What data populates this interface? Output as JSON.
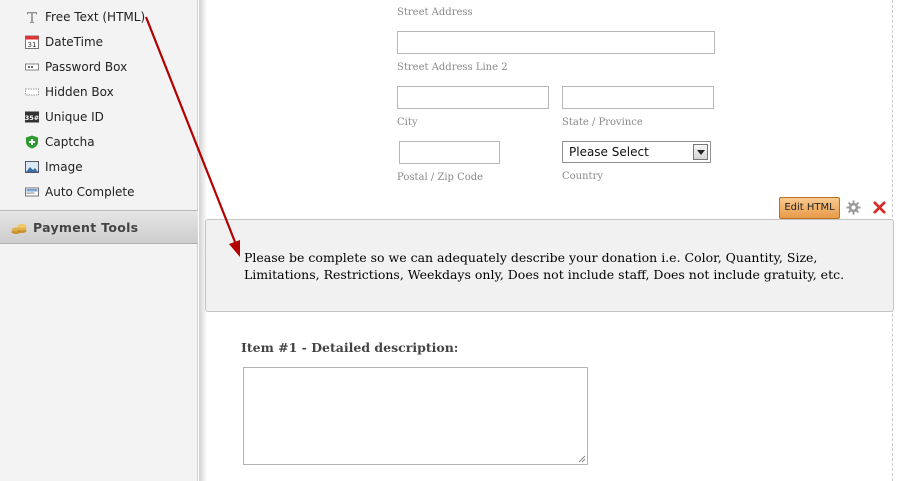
{
  "sidebar": {
    "items": [
      {
        "label": "Free Text (HTML)",
        "icon": "text-t-icon"
      },
      {
        "label": "DateTime",
        "icon": "calendar-icon"
      },
      {
        "label": "Password Box",
        "icon": "password-icon"
      },
      {
        "label": "Hidden Box",
        "icon": "hidden-box-icon"
      },
      {
        "label": "Unique ID",
        "icon": "unique-id-icon"
      },
      {
        "label": "Captcha",
        "icon": "shield-plus-icon"
      },
      {
        "label": "Image",
        "icon": "image-icon"
      },
      {
        "label": "Auto Complete",
        "icon": "auto-complete-icon"
      }
    ],
    "section": {
      "label": "Payment Tools",
      "icon": "coins-icon"
    },
    "calendar_day": "31",
    "unique_id_glyph": "35#"
  },
  "address": {
    "street_address_label": "Street Address",
    "street_address_2_label": "Street Address Line 2",
    "city_label": "City",
    "state_label": "State / Province",
    "postal_label": "Postal / Zip Code",
    "country_label": "Country",
    "country_select_value": "Please Select"
  },
  "html_block": {
    "text": "Please be complete so we can adequately describe your donation i.e. Color, Quantity, Size, Limitations, Restrictions, Weekdays only, Does not include staff, Does not include gratuity, etc.",
    "edit_button_label": "Edit HTML"
  },
  "item_field": {
    "label": "Item #1 - Detailed description:",
    "value": ""
  },
  "colors": {
    "arrow": "#b30000",
    "edit_button": "#f0a95e",
    "close": "#d42b2b"
  }
}
